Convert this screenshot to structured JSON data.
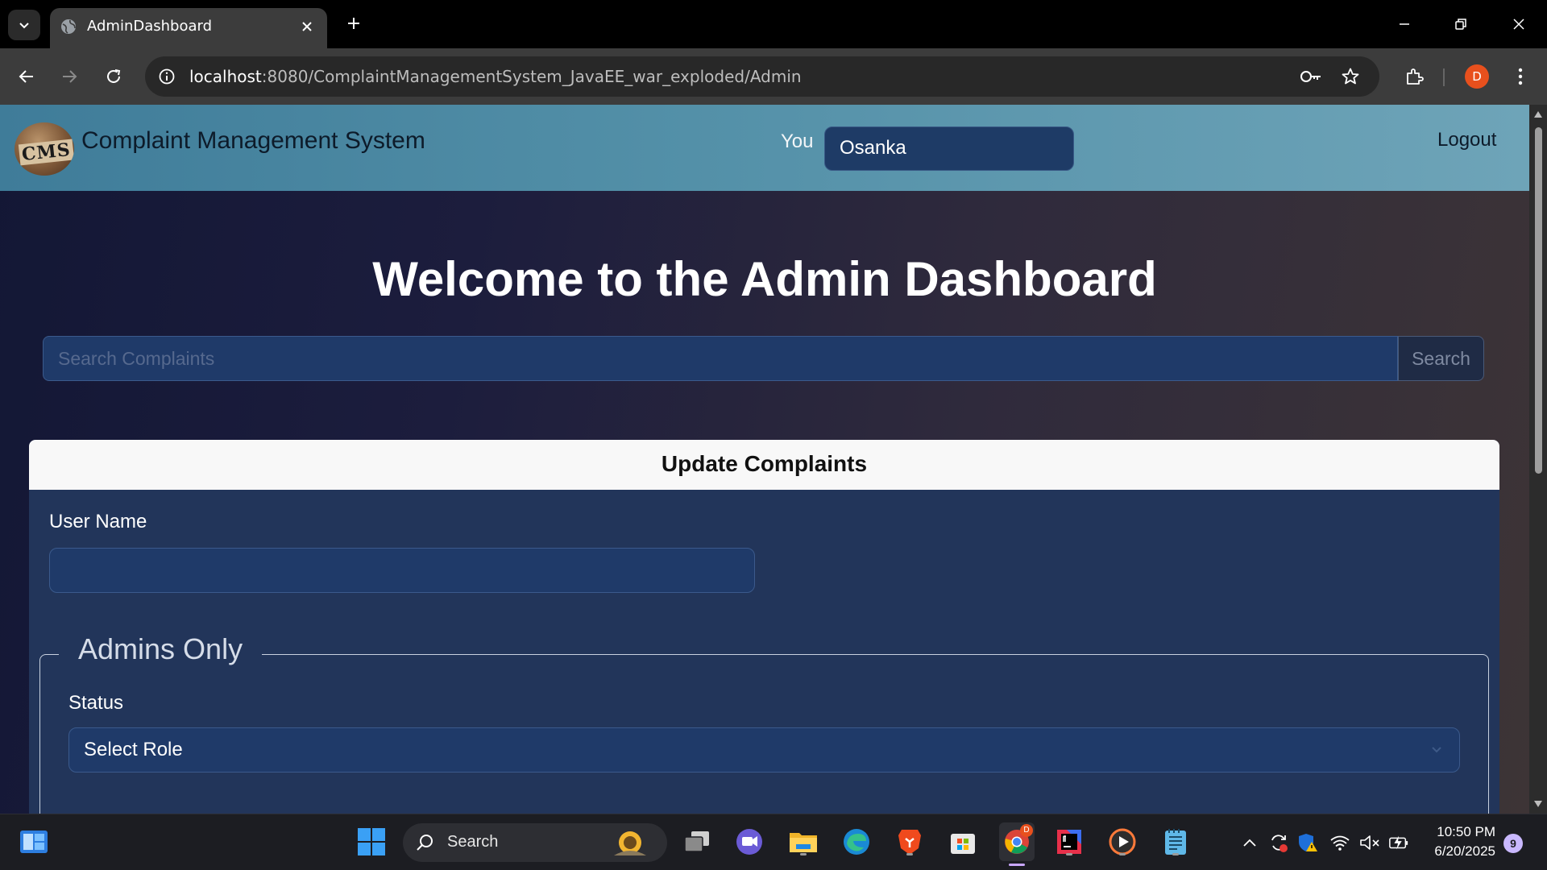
{
  "browser": {
    "tab_title": "AdminDashboard",
    "url_host": "localhost",
    "url_rest": ":8080/ComplaintManagementSystem_JavaEE_war_exploded/Admin",
    "profile_initial": "D",
    "accent_color": "#e8501d"
  },
  "app": {
    "brand": "Complaint Management System",
    "logo_text": "CMS",
    "you_label": "You",
    "you_value": "Osanka",
    "logout": "Logout",
    "nav_color": "#5390a8"
  },
  "main": {
    "title": "Welcome to the Admin Dashboard",
    "search_placeholder": "Search Complaints",
    "search_button": "Search"
  },
  "form": {
    "header": "Update Complaints",
    "user_name_label": "User Name",
    "user_name_value": "",
    "fieldset_legend": "Admins Only",
    "status_label": "Status",
    "status_selected": "Select Role"
  },
  "taskbar": {
    "search_label": "Search",
    "time": "10:50 PM",
    "date": "6/20/2025",
    "notification_count": "9",
    "chrome_badge": "D"
  }
}
